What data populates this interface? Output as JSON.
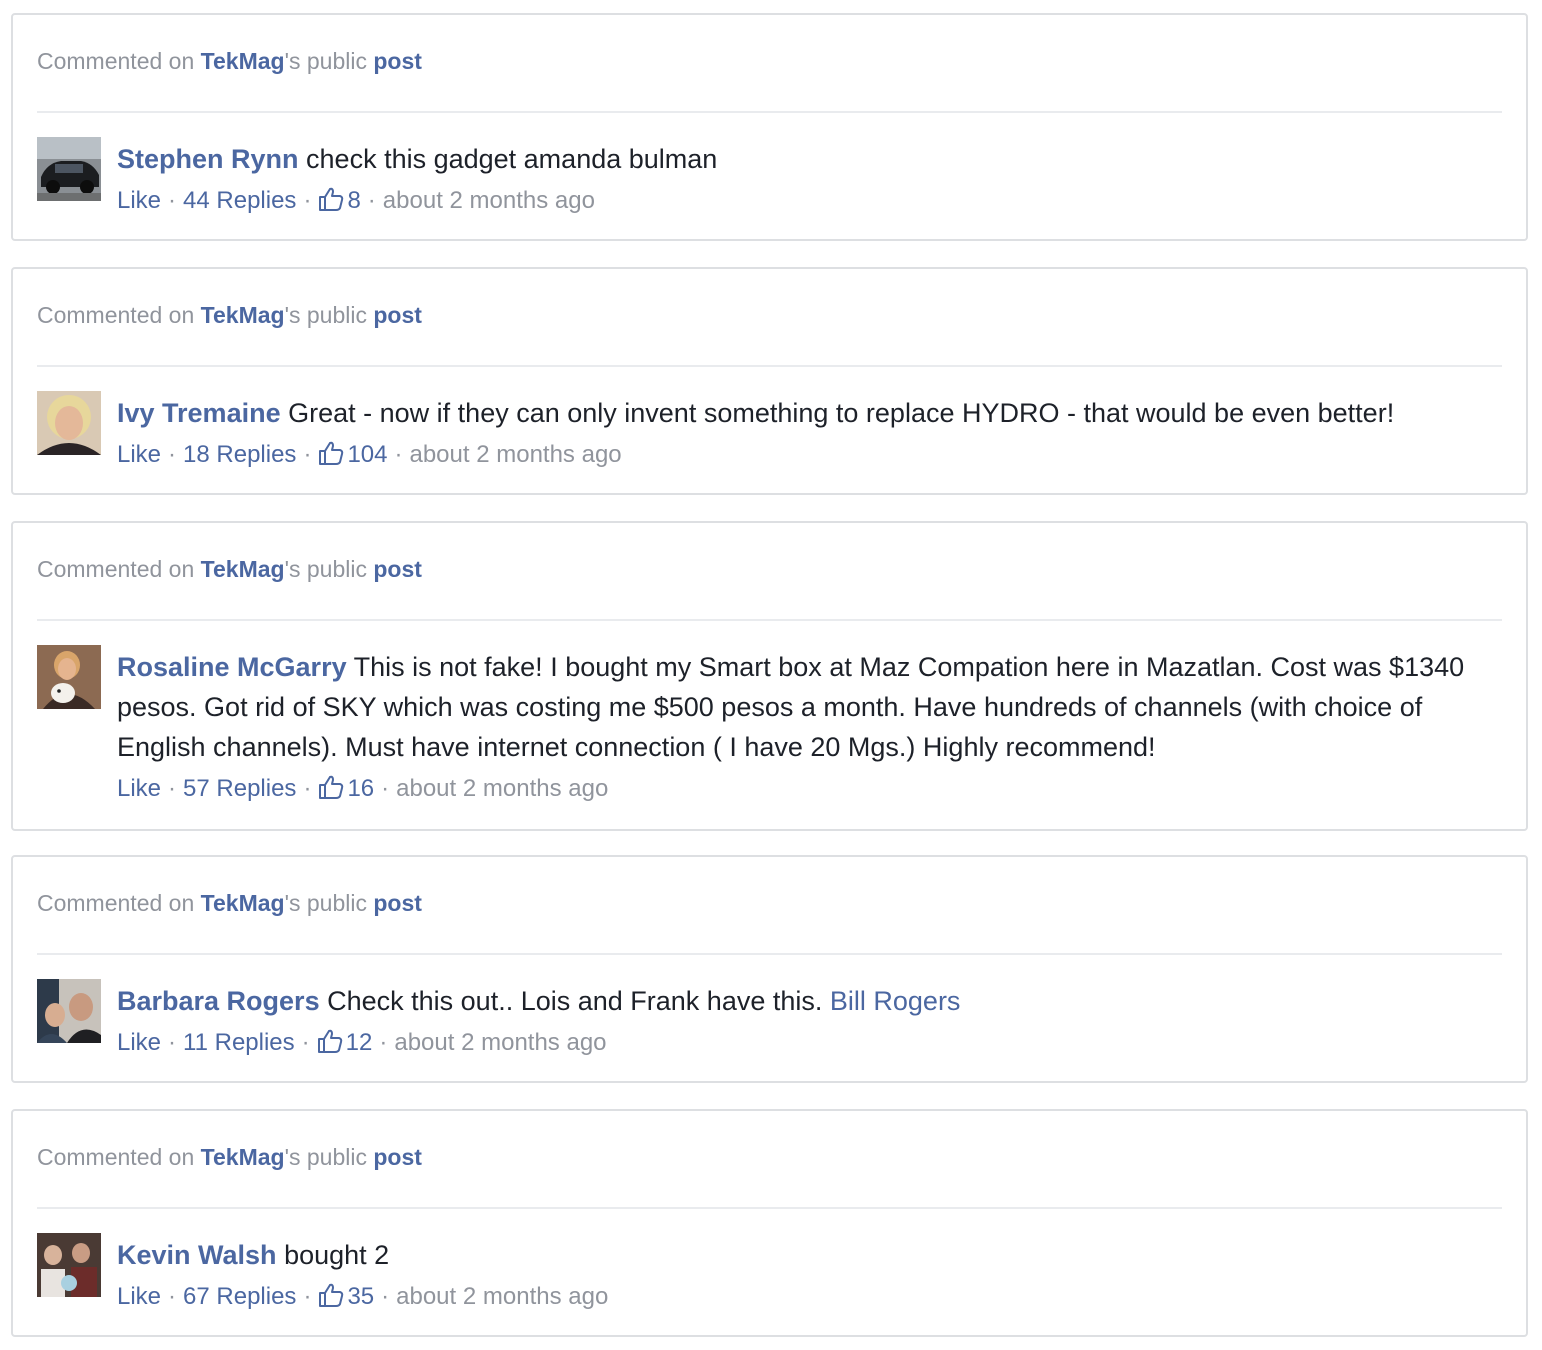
{
  "header": {
    "prefix": "Commented on",
    "page_name": "TekMag",
    "possessive": "'s public",
    "post_link": "post"
  },
  "actions": {
    "like": "Like",
    "separator": "·"
  },
  "colors": {
    "link": "#4b67a1",
    "muted": "#90949c",
    "text": "#1d2129",
    "border": "#dddfe2"
  },
  "comments": [
    {
      "author": "Stephen Rynn",
      "text": "check this gadget amanda bulman",
      "mention": "",
      "replies": "44 Replies",
      "likes": "8",
      "time": "about 2 months ago",
      "avatar_icon": "car-photo-avatar"
    },
    {
      "author": "Ivy Tremaine",
      "text": "Great - now if they can only invent something to replace HYDRO - that would be even better!",
      "mention": "",
      "replies": "18 Replies",
      "likes": "104",
      "time": "about 2 months ago",
      "avatar_icon": "person-photo-avatar"
    },
    {
      "author": "Rosaline McGarry",
      "text": "This is not fake! I bought my Smart box at Maz Compation here in Mazatlan. Cost was $1340 pesos. Got rid of SKY which was costing me $500 pesos a month. Have hundreds of channels (with choice of English channels). Must have internet connection ( I have 20 Mgs.) Highly recommend!",
      "mention": "",
      "replies": "57 Replies",
      "likes": "16",
      "time": "about 2 months ago",
      "avatar_icon": "person-with-dog-avatar"
    },
    {
      "author": "Barbara Rogers",
      "text": "Check this out.. Lois and Frank have this.",
      "mention": "Bill Rogers",
      "replies": "11 Replies",
      "likes": "12",
      "time": "about 2 months ago",
      "avatar_icon": "couple-photo-avatar"
    },
    {
      "author": "Kevin Walsh",
      "text": "bought 2",
      "mention": "",
      "replies": "67 Replies",
      "likes": "35",
      "time": "about 2 months ago",
      "avatar_icon": "group-photo-avatar"
    }
  ]
}
